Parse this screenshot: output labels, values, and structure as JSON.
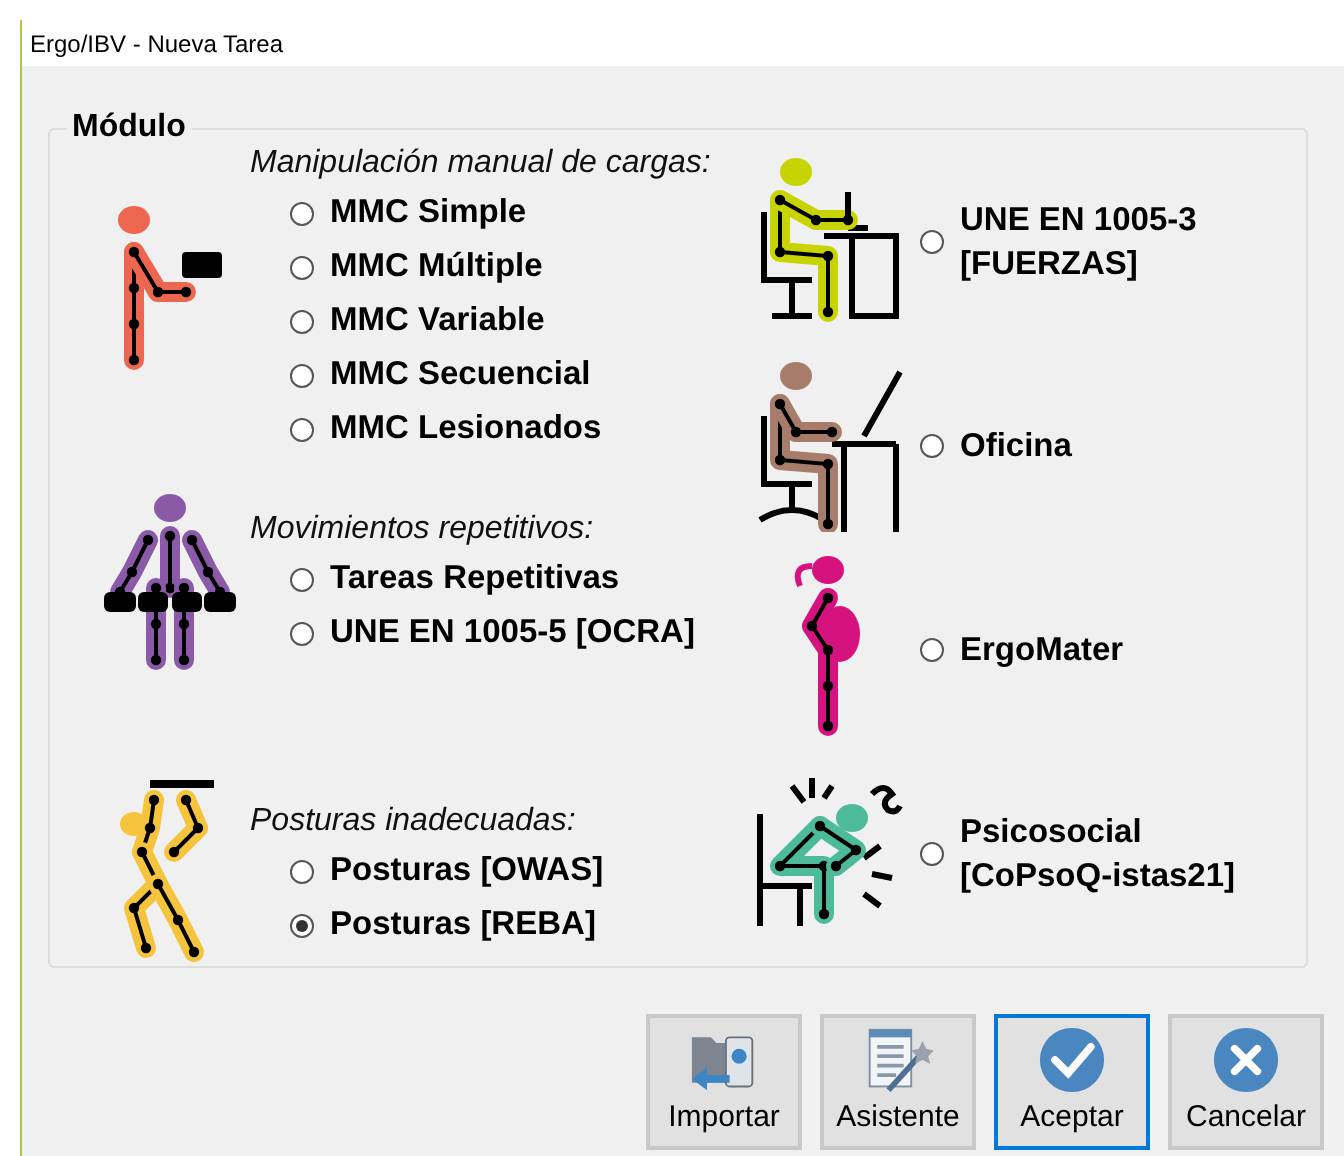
{
  "window": {
    "title": "Ergo/IBV - Nueva Tarea"
  },
  "group": {
    "legend": "Módulo",
    "left_sections": [
      {
        "kind": "lifting",
        "heading": "Manipulación manual de cargas:",
        "options": [
          {
            "label": "MMC Simple",
            "selected": false
          },
          {
            "label": "MMC Múltiple",
            "selected": false
          },
          {
            "label": "MMC Variable",
            "selected": false
          },
          {
            "label": "MMC Secuencial",
            "selected": false
          },
          {
            "label": "MMC Lesionados",
            "selected": false
          }
        ]
      },
      {
        "kind": "repetitive",
        "heading": "Movimientos repetitivos:",
        "options": [
          {
            "label": "Tareas Repetitivas",
            "selected": false
          },
          {
            "label": "UNE EN 1005-5 [OCRA]",
            "selected": false
          }
        ]
      },
      {
        "kind": "posture",
        "heading": "Posturas inadecuadas:",
        "options": [
          {
            "label": "Posturas [OWAS]",
            "selected": false
          },
          {
            "label": "Posturas [REBA]",
            "selected": true
          }
        ]
      }
    ],
    "right_options": [
      {
        "kind": "seated-forces",
        "label": "UNE EN 1005-3\n[FUERZAS]",
        "selected": false
      },
      {
        "kind": "office",
        "label": "Oficina",
        "selected": false
      },
      {
        "kind": "pregnant",
        "label": "ErgoMater",
        "selected": false
      },
      {
        "kind": "stressed",
        "label": "Psicosocial\n[CoPsoQ-istas21]",
        "selected": false
      }
    ]
  },
  "buttons": [
    {
      "kind": "import",
      "label": "Importar",
      "focused": false
    },
    {
      "kind": "wizard",
      "label": "Asistente",
      "focused": false
    },
    {
      "kind": "accept",
      "label": "Aceptar",
      "focused": true
    },
    {
      "kind": "cancel",
      "label": "Cancelar",
      "focused": false
    }
  ]
}
